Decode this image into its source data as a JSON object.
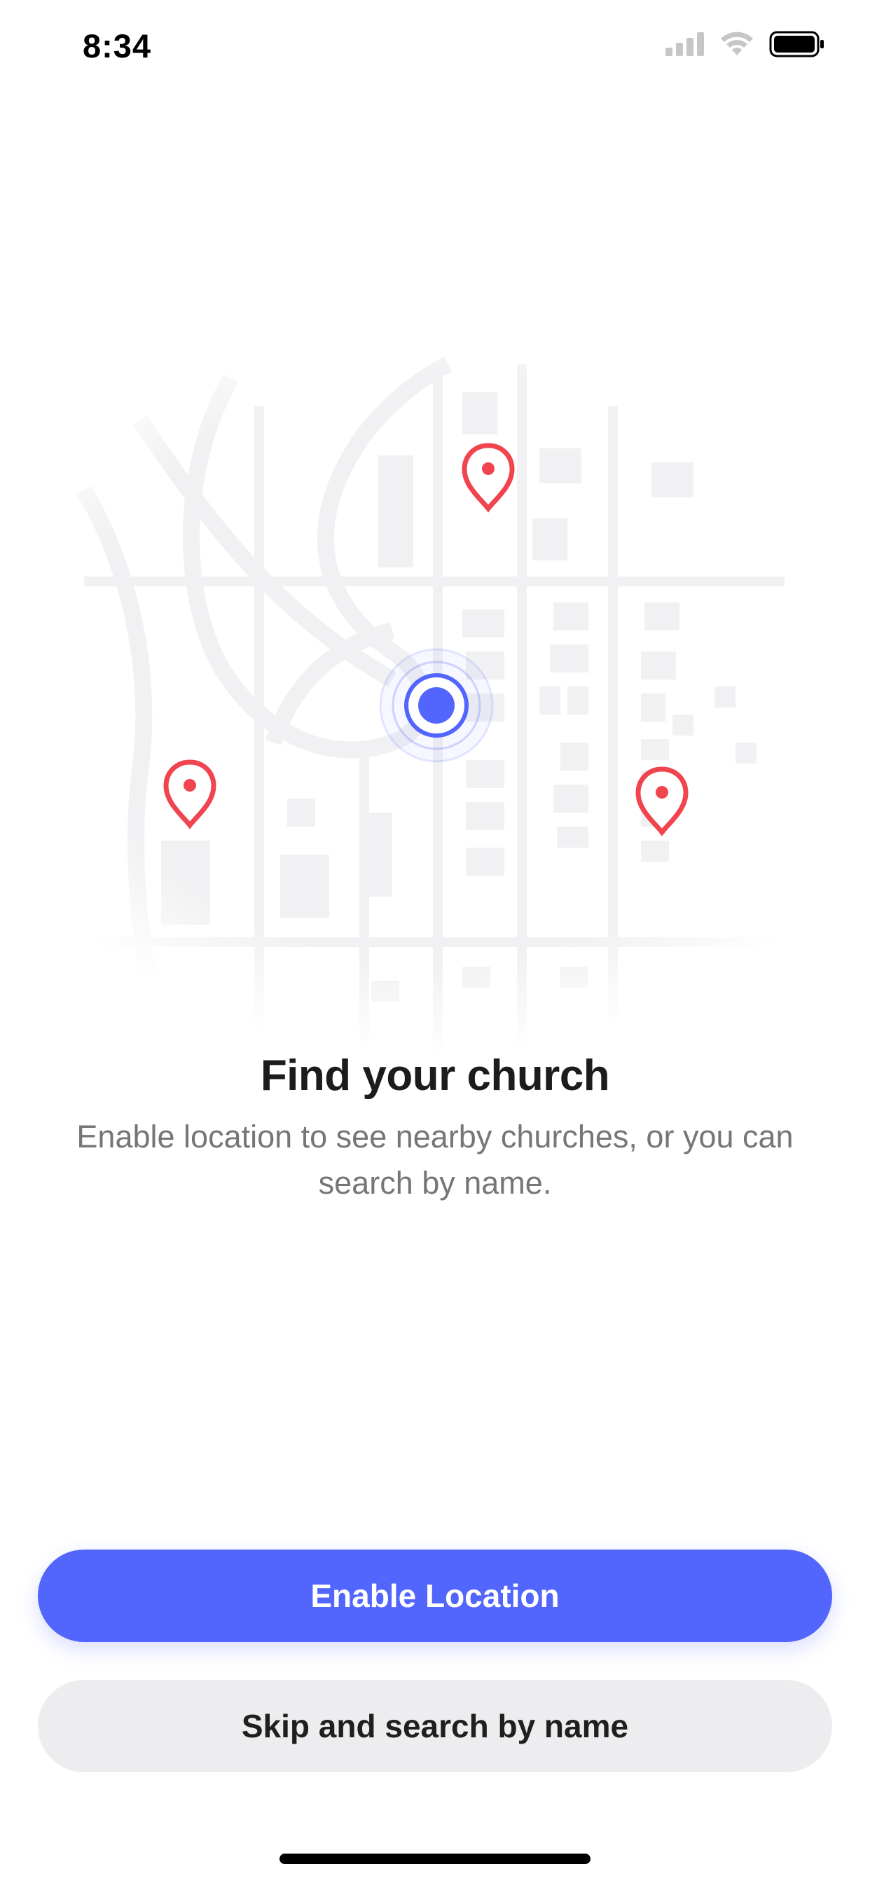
{
  "status_bar": {
    "time": "8:34",
    "icons": [
      "cellular-signal-icon",
      "wifi-icon",
      "battery-icon"
    ]
  },
  "illustration": {
    "pins": [
      "location-pin-icon",
      "location-pin-icon",
      "location-pin-icon"
    ],
    "current_location": "current-location-icon",
    "pin_color": "#f0444f",
    "location_color": "#5265fd"
  },
  "content": {
    "title": "Find your church",
    "subtitle": "Enable location to see nearby churches, or you can search by name."
  },
  "actions": {
    "enable_location_label": "Enable Location",
    "skip_label": "Skip and search by name"
  },
  "colors": {
    "primary": "#5265fd",
    "secondary_bg": "#ededef",
    "subtitle": "#76767a"
  }
}
